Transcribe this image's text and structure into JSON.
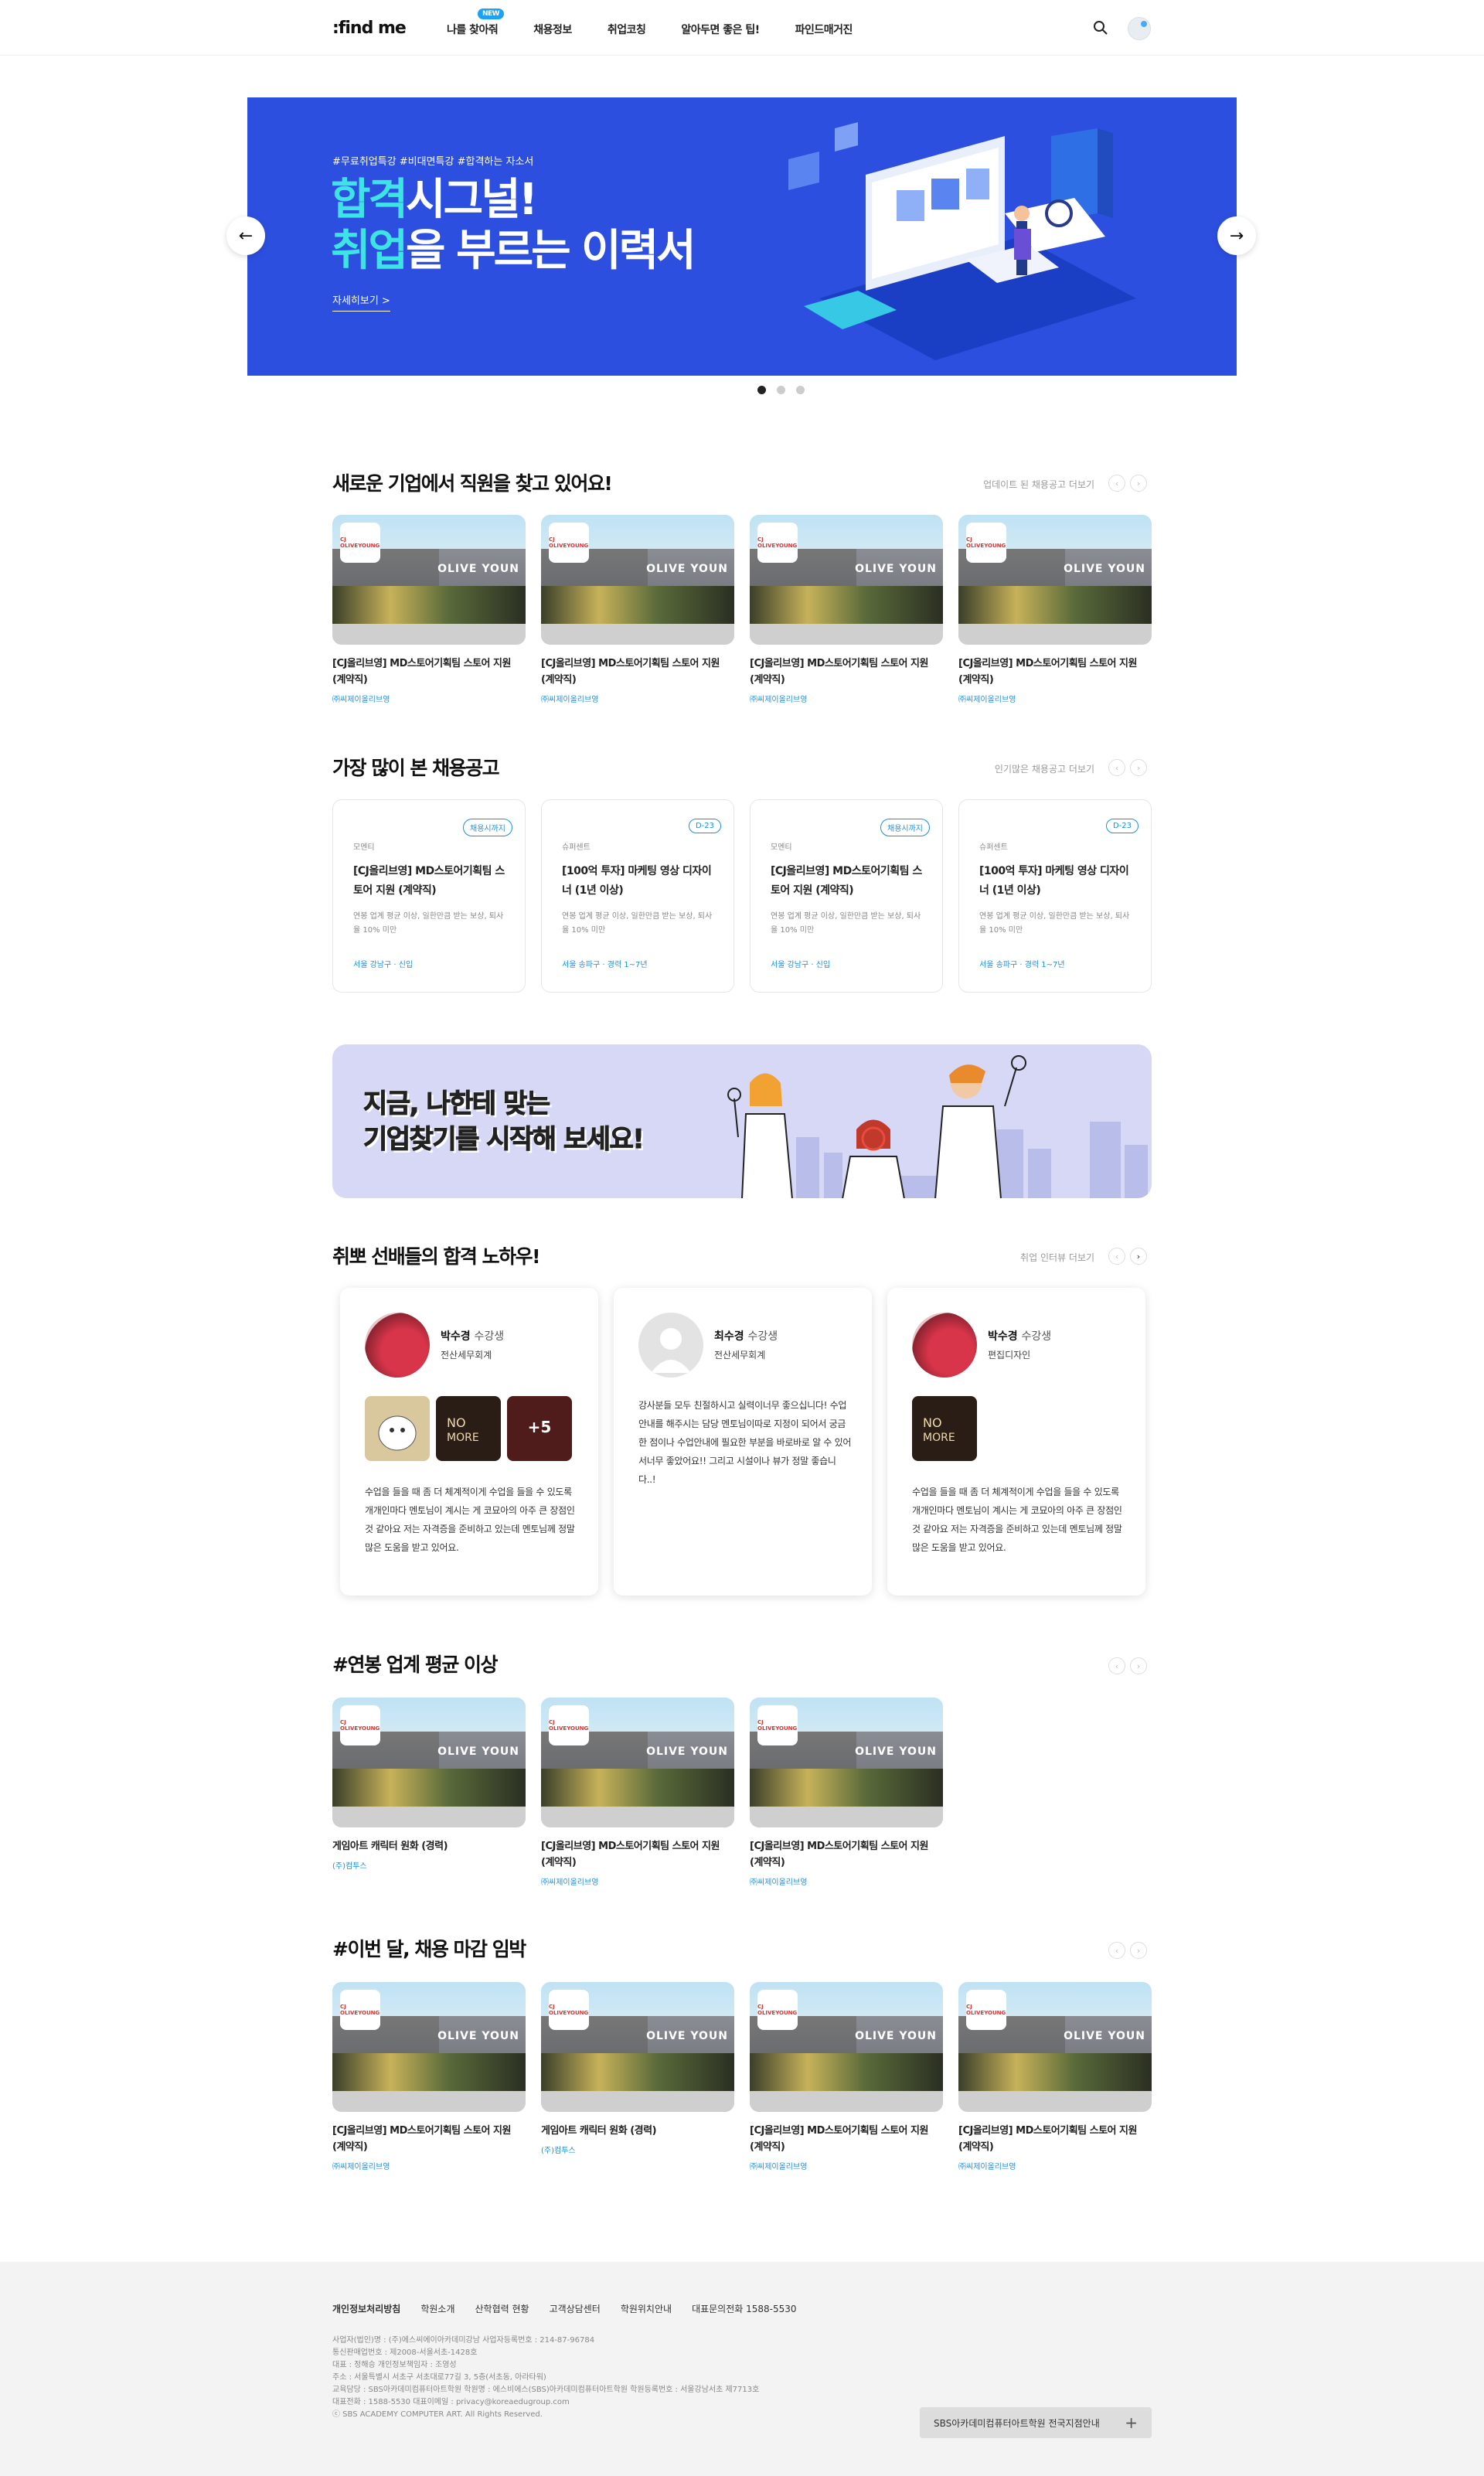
{
  "header": {
    "logo": ":find me",
    "nav": [
      {
        "label": "나를 찾아줘",
        "badge": "NEW"
      },
      {
        "label": "채용정보"
      },
      {
        "label": "취업코칭"
      },
      {
        "label": "알아두면 좋은 팁!"
      },
      {
        "label": "파인드매거진"
      }
    ]
  },
  "hero": {
    "tags": "#무료취업특강 #비대면특강 #합격하는 자소서",
    "title_line1_hl": "합격",
    "title_line1_rest": "시그널!",
    "title_line2_hl": "취업",
    "title_line2_rest": "을 부르는 이력서",
    "more": "자세히보기 >"
  },
  "new_jobs": {
    "title": "새로운 기업에서 직원을 찾고 있어요!",
    "more": "업데이트 된 채용공고 더보기",
    "items": [
      {
        "title": "[CJ올리브영] MD스토어기획팀 스토어 지원 (계약직)",
        "company": "㈜씨제이올리브영"
      },
      {
        "title": "[CJ올리브영] MD스토어기획팀 스토어 지원 (계약직)",
        "company": "㈜씨제이올리브영"
      },
      {
        "title": "[CJ올리브영] MD스토어기획팀 스토어 지원 (계약직)",
        "company": "㈜씨제이올리브영"
      },
      {
        "title": "[CJ올리브영] MD스토어기획팀 스토어 지원 (계약직)",
        "company": "㈜씨제이올리브영"
      }
    ]
  },
  "popular": {
    "title": "가장 많이 본 채용공고",
    "more": "인기많은 채용공고 더보기",
    "items": [
      {
        "type": "모멘티",
        "badge": "채용시까지",
        "title": "[CJ올리브영] MD스토어기획팀 스토어 지원 (계약직)",
        "desc": "연봉 업계 평균 이상, 일한만큼 받는 보상, 퇴사율 10% 미만",
        "loc": "서울 강남구 · 신입"
      },
      {
        "type": "슈퍼센트",
        "badge": "D-23",
        "title": "[100억 투자] 마케팅 영상 디자이너 (1년 이상)",
        "desc": "연봉 업계 평균 이상, 일한만큼 받는 보상, 퇴사율 10% 미만",
        "loc": "서울 송파구 · 경력 1~7년"
      },
      {
        "type": "모멘티",
        "badge": "채용시까지",
        "title": "[CJ올리브영] MD스토어기획팀 스토어 지원 (계약직)",
        "desc": "연봉 업계 평균 이상, 일한만큼 받는 보상, 퇴사율 10% 미만",
        "loc": "서울 강남구 · 신입"
      },
      {
        "type": "슈퍼센트",
        "badge": "D-23",
        "title": "[100억 투자] 마케팅 영상 디자이너 (1년 이상)",
        "desc": "연봉 업계 평균 이상, 일한만큼 받는 보상, 퇴사율 10% 미만",
        "loc": "서울 송파구 · 경력 1~7년"
      }
    ]
  },
  "banner": {
    "line1": "지금, 나한테 맞는",
    "line2": "기업찾기를 시작해 보세요!"
  },
  "reviews": {
    "title": "취뽀 선배들의 합격 노하우!",
    "more": "취업 인터뷰 더보기",
    "items": [
      {
        "name": "박수경",
        "suffix": "수강생",
        "major": "전산세무회계",
        "text": "수업을 들을 때 좀 더 체계적이게 수업을 들을 수 있도록 개개인마다 멘토님이 계시는 게 코묘아의 아주 큰 장점인 것 같아요 저는 자격증을 준비하고 있는데 멘토님께 정말 많은 도움을 받고 있어요.",
        "more_count": "+5"
      },
      {
        "name": "최수경",
        "suffix": "수강생",
        "major": "전산세무회계",
        "text": "강사분들 모두 친절하시고 실력이너무 좋으십니다! 수업안내를 해주시는 담당 멘토님이따로 지정이 되어서 궁금한 점이나 수업안내에 필요한 부분을 바로바로 알 수 있어서너무 좋았어요!! 그리고 시설이나 뷰가 정말 좋습니다..!"
      },
      {
        "name": "박수경",
        "suffix": "수강생",
        "major": "편집디자인",
        "text": "수업을 들을 때 좀 더 체계적이게 수업을 들을 수 있도록 개개인마다 멘토님이 계시는 게 코묘아의 아주 큰 장점인 것 같아요 저는 자격증을 준비하고 있는데 멘토님께 정말 많은 도움을 받고 있어요."
      }
    ]
  },
  "salary": {
    "title": "#연봉 업계 평균 이상",
    "items": [
      {
        "title": "게임아트 캐릭터 원화 (경력)",
        "company": "(주)컴투스"
      },
      {
        "title": "[CJ올리브영] MD스토어기획팀 스토어 지원 (계약직)",
        "company": "㈜씨제이올리브영"
      },
      {
        "title": "[CJ올리브영] MD스토어기획팀 스토어 지원 (계약직)",
        "company": "㈜씨제이올리브영"
      }
    ]
  },
  "deadline": {
    "title": "#이번 달, 채용 마감 임박",
    "items": [
      {
        "title": "[CJ올리브영] MD스토어기획팀 스토어 지원 (계약직)",
        "company": "㈜씨제이올리브영"
      },
      {
        "title": "게임아트 캐릭터 원화 (경력)",
        "company": "(주)컴투스"
      },
      {
        "title": "[CJ올리브영] MD스토어기획팀 스토어 지원 (계약직)",
        "company": "㈜씨제이올리브영"
      },
      {
        "title": "[CJ올리브영] MD스토어기획팀 스토어 지원 (계약직)",
        "company": "㈜씨제이올리브영"
      }
    ]
  },
  "footer": {
    "links": [
      "개인정보처리방침",
      "학원소개",
      "산학협력 현황",
      "고객상담센터",
      "학원위치안내",
      "대표문의전화 1588-5530"
    ],
    "info": [
      "사업자(법인)명 : (주)에스씨에이아카데미강남   사업자등록번호 : 214-87-96784",
      "통신판매업번호 : 제2008-서울서초-1428호",
      "대표 : 정해승    개인정보책임자 : 조영성",
      "주소 : 서울특별시 서초구 서초대로77길 3, 5층(서초동, 아라타워)",
      "교육담당 : SBS아카데미컴퓨터아트학원    학원명 : 에스비에스(SBS)아카데미컴퓨터아트학원    학원등록번호 : 서울강남서초 제7713호",
      "대표전화 : 1588-5530    대표이메일 : privacy@koreaedugroup.com",
      "ⓒ SBS ACADEMY COMPUTER ART. All Rights Reserved."
    ],
    "branch_btn": "SBS아카데미컴퓨터아트학원 전국지점안내"
  }
}
